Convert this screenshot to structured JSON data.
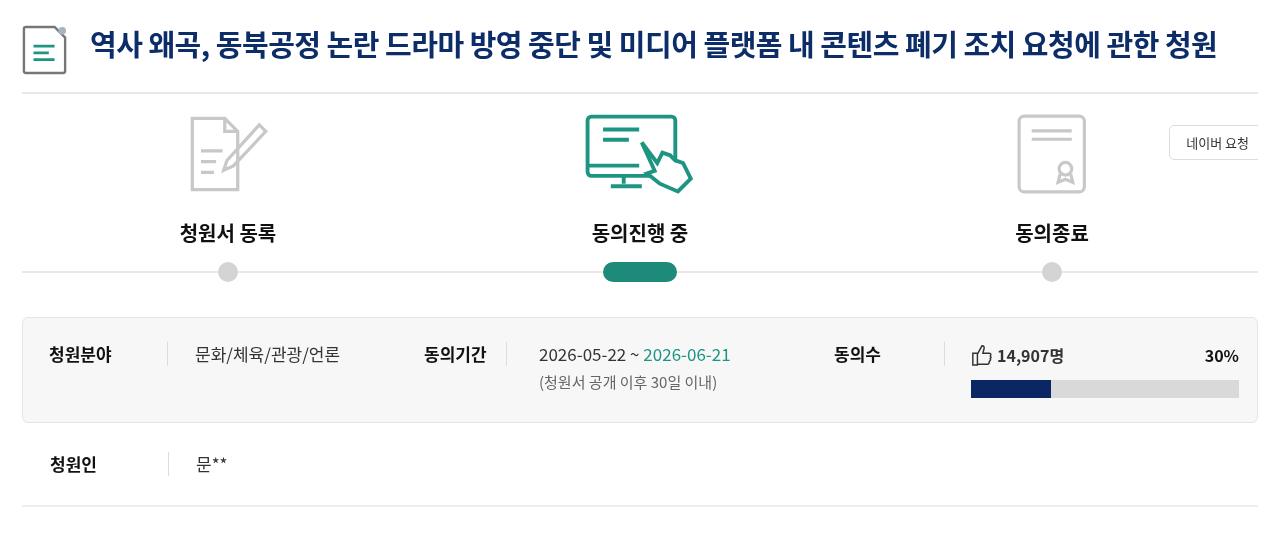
{
  "title": "역사 왜곡, 동북공정 논란 드라마 방영 중단 및 미디어 플랫폼 내 콘텐츠 폐기 조치 요청에 관한 청원",
  "steps": [
    {
      "kind": "write",
      "label": "청원서 동록",
      "selected": false
    },
    {
      "kind": "agree",
      "label": "동의진행 중",
      "selected": true
    },
    {
      "kind": "end",
      "label": "동의종료",
      "selected": false
    }
  ],
  "naver_button": "네이버 요청",
  "info": {
    "field_label": "청원분야",
    "field_value": "문화/체육/관광/언론",
    "period_label": "동의기간",
    "period_start": "2026-05-22 ~",
    "period_end": "2026-06-21",
    "period_note": "(청원서 공개 이후 30일 이내)",
    "count_label": "동의수",
    "count_value": "14,907명",
    "percent": "30%",
    "level": 0.3
  },
  "petitioner": {
    "label": "청원인",
    "value": "문**"
  }
}
